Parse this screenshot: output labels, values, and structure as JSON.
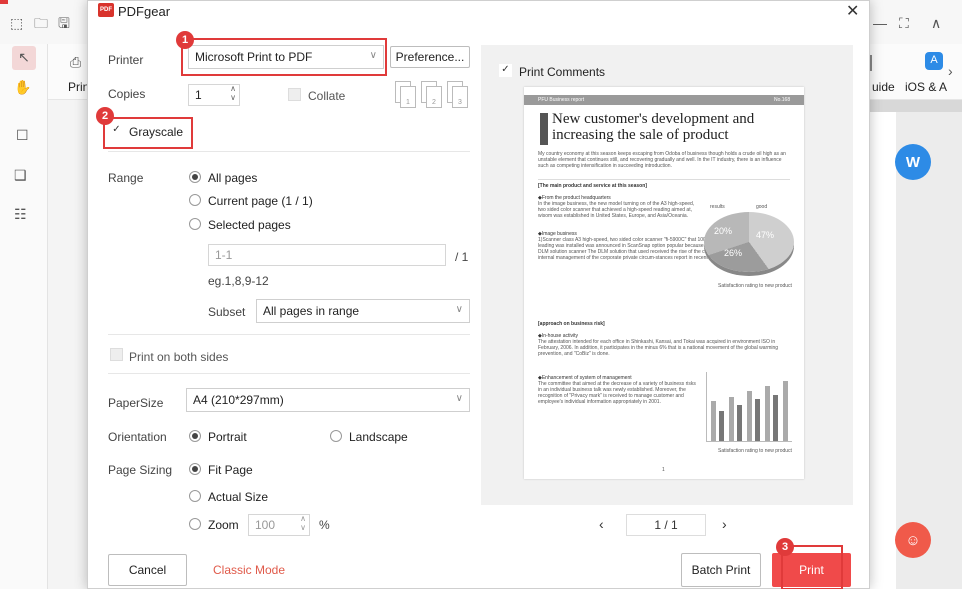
{
  "background": {
    "tools_left": [
      "Prin"
    ],
    "tools_right": [
      "uide",
      "iOS & A"
    ]
  },
  "dialog": {
    "app_title": "PDFgear",
    "logo_text": "PDF"
  },
  "printer": {
    "label": "Printer",
    "value": "Microsoft Print to PDF",
    "preferences_label": "Preference..."
  },
  "copies": {
    "label": "Copies",
    "value": "1",
    "collate_label": "Collate",
    "collate_checked": false
  },
  "grayscale": {
    "label": "Grayscale",
    "checked": true
  },
  "range": {
    "label": "Range",
    "options": [
      "All pages",
      "Current page (1 / 1)",
      "Selected pages"
    ],
    "selected": "All pages",
    "pages_placeholder": "1-1",
    "pages_total": "/ 1",
    "hint": "eg.1,8,9-12",
    "subset_label": "Subset",
    "subset_value": "All pages in range"
  },
  "duplex": {
    "label": "Print on both sides",
    "checked": false
  },
  "paper_size": {
    "label": "PaperSize",
    "value": "A4 (210*297mm)"
  },
  "orientation": {
    "label": "Orientation",
    "options": [
      "Portrait",
      "Landscape"
    ],
    "selected": "Portrait"
  },
  "page_sizing": {
    "label": "Page Sizing",
    "options": [
      "Fit Page",
      "Actual Size",
      "Zoom"
    ],
    "selected": "Fit Page",
    "zoom_value": "100",
    "zoom_unit": "%"
  },
  "preview": {
    "print_comments_label": "Print Comments",
    "print_comments_checked": true,
    "page_indicator": "1 / 1",
    "doc": {
      "header_left": "PFU Business report",
      "header_right": "No.168",
      "title": "New customer's development and increasing the sale of product",
      "intro": "My country economy at this season keeps escaping from Odoba of business though holds a crude oil high as an unstable element that continues still, and recovering gradually and well. In the IT industry, there is an influence such as competing intensification in succeeding introduction.",
      "section1": "[The main product and service at this season]",
      "item1_title": "◆From the product headquarters",
      "item1_text": "In the image business, the new model turning on of the A3 high-speed, two sided color scanner that achieved a high-speed reading aimed at, wisom was established in United States, Europe, and Asia/Oceania.",
      "item2_title": "◆Image business",
      "item2_text": "1)Scanner class A3 high-speed, two sided color scanner \"fi-5900C\" that 100 high-n function to enable industry-leading was installed was announced in ScanSnap option popular because of an office and individual use. 2) DLM solution scanner The DLM solution that used received the rise of the concern to efficient management and internal management of the corporate private circum-stances report in recent years and attested attention.",
      "pie_caption": "Satisfaction rating to new product",
      "pie_labels": [
        "20%",
        "47%",
        "26%"
      ],
      "pie_legend": [
        "results",
        "good"
      ],
      "section2": "[approach on business risk]",
      "item3_title": "◆In-house activity",
      "item3_text": "The attestation intended for each office in Shinkashi, Kansai, and Tokai was acquired in environment ISO in February, 2006. In addition, it participates in the minus 6% that is a national movement of the global warming prevention, and \"CoBiz\" is done.",
      "item4_title": "◆Enhancement of system of management",
      "item4_text": "The committee that aimed at the decrease of a variety of business risks in an individual business talk was newly established. Moreover, the recognition of \"Privacy mark\" is received to manage customer and employee's individual information appropriately in 2001.",
      "bar_caption": "Satisfaction rating to new product",
      "page_number": "1"
    }
  },
  "footer": {
    "cancel": "Cancel",
    "classic_mode": "Classic Mode",
    "batch_print": "Batch Print",
    "print": "Print"
  },
  "callouts": [
    "1",
    "2",
    "3"
  ],
  "colors": {
    "accent_red": "#e03a3a",
    "print_button": "#f04a4a",
    "classic_mode_text": "#e05a4a",
    "word_button": "#2d8be6",
    "bot_button": "#f05a4a",
    "logo": "#d8332c"
  }
}
